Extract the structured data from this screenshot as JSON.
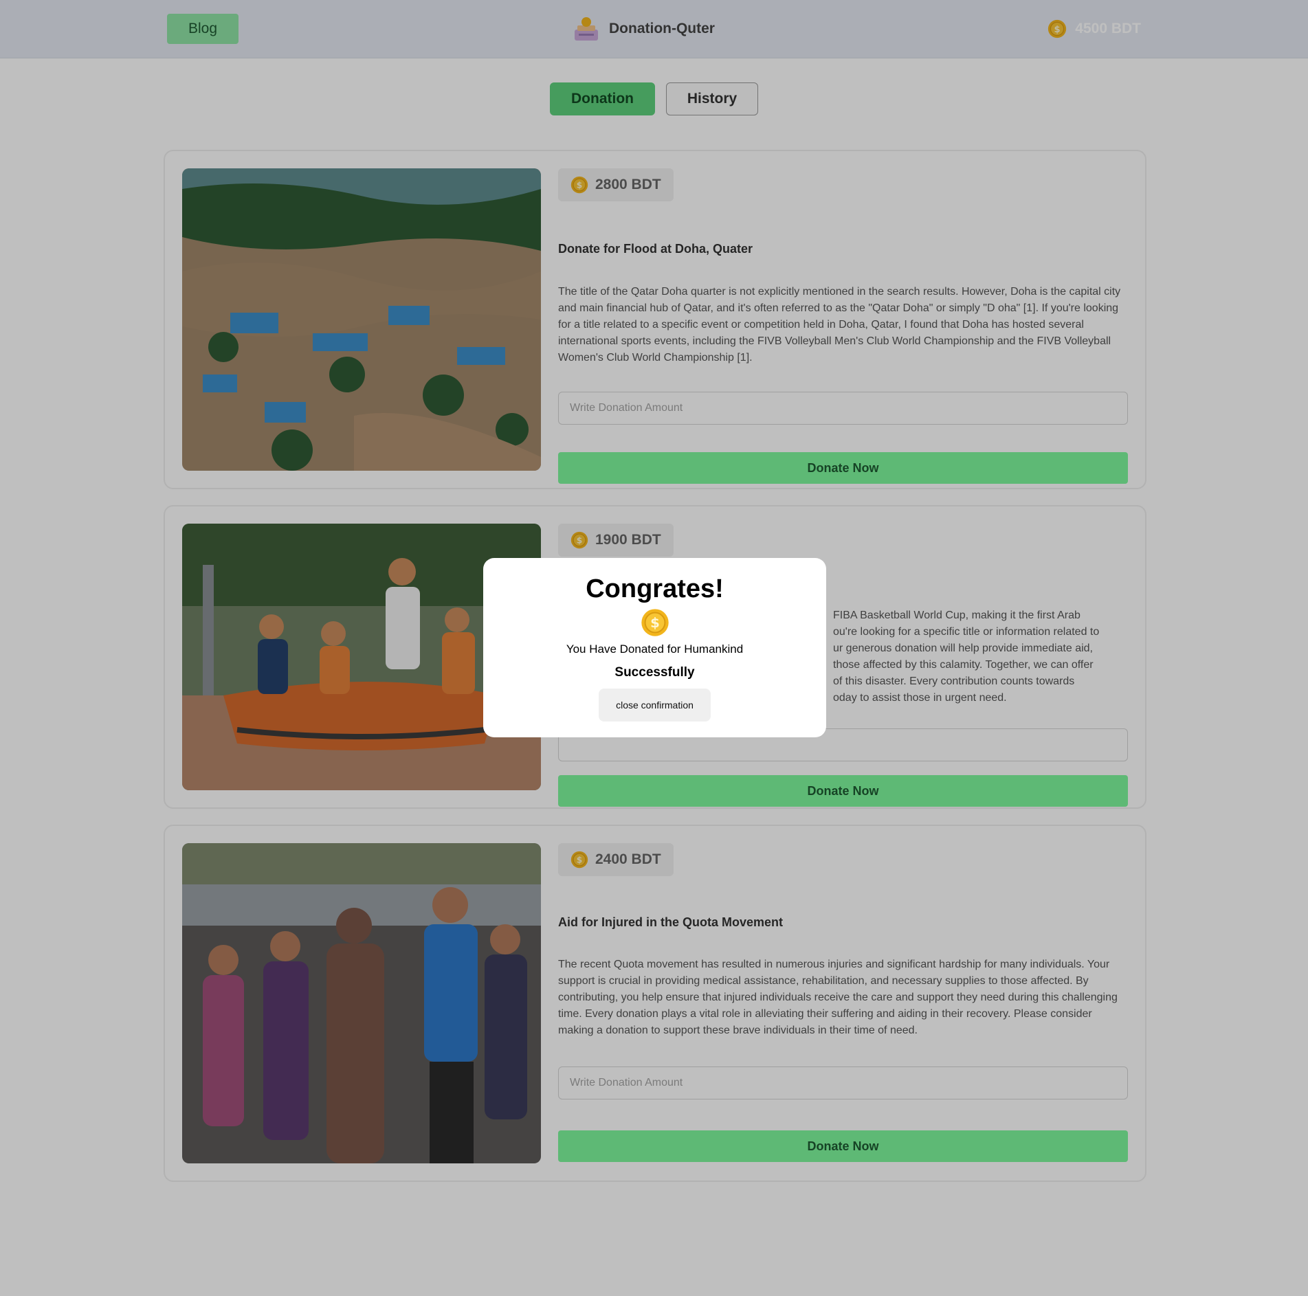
{
  "header": {
    "blog_label": "Blog",
    "brand_name": "Donation-Quter",
    "balance": "4500 BDT"
  },
  "tabs": [
    {
      "label": "Donation",
      "active": true
    },
    {
      "label": "History",
      "active": false
    }
  ],
  "cards": [
    {
      "amount": "2800 BDT",
      "title": "Donate for Flood at Doha, Quater",
      "description": "The title of the Qatar Doha quarter is not explicitly mentioned in the search results. However, Doha is the capital city and main financial hub of Qatar, and it's often referred to as the \"Qatar Doha\" or simply \"D oha\" [1]. If you're looking for a title related to a specific event or competition held in Doha, Qatar, I found that Doha has hosted several international sports events, including the FIVB Volleyball Men's Club World Championship and the FIVB Volleyball Women's Club World Championship [1].",
      "input_placeholder": "Write Donation Amount",
      "button_label": "Donate Now",
      "image": "aerial view of flooded town"
    },
    {
      "amount": "1900 BDT",
      "title": "",
      "description_lines": [
        "FIBA Basketball World Cup, making it the first Arab",
        "ou're looking for a specific title or information related to",
        "ur generous donation will help provide immediate aid,",
        "those affected by this calamity. Together, we can offer",
        "of this disaster. Every contribution counts towards",
        "oday to assist those in urgent need."
      ],
      "input_placeholder": "",
      "button_label": "Donate Now",
      "image": "rescue team in an orange inflatable boat on flood water"
    },
    {
      "amount": "2400 BDT",
      "title": "Aid for Injured in the Quota Movement",
      "description": "The recent Quota movement has resulted in numerous injuries and significant hardship for many individuals. Your support is crucial in providing medical assistance, rehabilitation, and necessary supplies to those affected. By contributing, you help ensure that injured individuals receive the care and support they need during this challenging time. Every donation plays a vital role in alleviating their suffering and aiding in their recovery. Please consider making a donation to support these brave individuals in their time of need.",
      "input_placeholder": "Write Donation Amount",
      "button_label": "Donate Now",
      "image": "crowd of people helping an injured person"
    }
  ],
  "modal": {
    "title": "Congrates!",
    "message": "You Have Donated for Humankind",
    "status": "Successfully",
    "close_label": "close confirmation"
  },
  "icons": {
    "coin": "coin-icon",
    "logo": "donation-box-logo"
  },
  "colors": {
    "accent_green": "#7ef79c",
    "tab_active": "#5ed07c",
    "header_bg": "#e4e9f2",
    "coin_gold": "#f2b51c"
  }
}
